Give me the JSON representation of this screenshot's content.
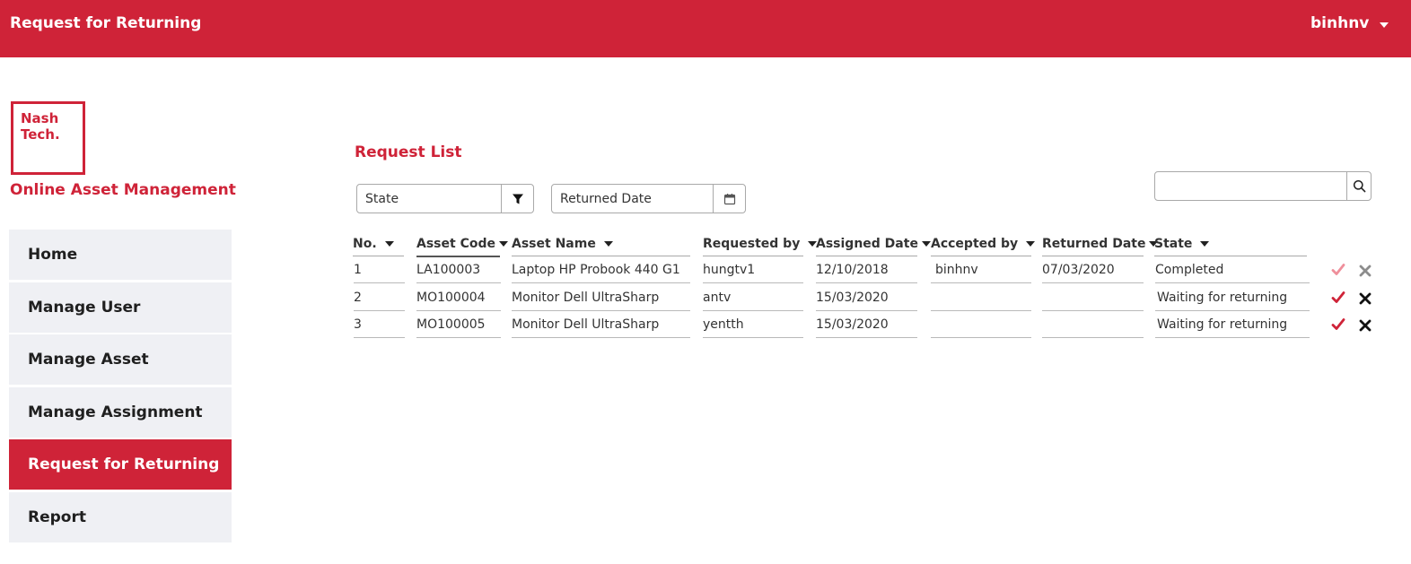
{
  "header": {
    "title": "Request for Returning",
    "user": "binhnv",
    "accent": "#cf2338"
  },
  "brand": {
    "logo_text": "Nash\nTech.",
    "app_name": "Online Asset Management"
  },
  "sidebar": {
    "items": [
      {
        "label": "Home"
      },
      {
        "label": "Manage User"
      },
      {
        "label": "Manage Asset"
      },
      {
        "label": "Manage Assignment"
      },
      {
        "label": "Request for Returning",
        "active": true
      },
      {
        "label": "Report"
      }
    ]
  },
  "main": {
    "title": "Request List",
    "filters": {
      "state_label": "State",
      "state_icon": "filter-icon",
      "returned_date_label": "Returned Date",
      "date_icon": "calendar-icon"
    },
    "search": {
      "value": "",
      "placeholder": "",
      "icon": "search-icon"
    },
    "table": {
      "columns": [
        "No.",
        "Asset Code",
        "Asset Name",
        "Requested by",
        "Assigned Date",
        "Accepted by",
        "Returned Date",
        "State"
      ],
      "rows": [
        {
          "no": "1",
          "asset_code": "LA100003",
          "asset_name": "Laptop HP Probook 440 G1",
          "requested_by": "hungtv1",
          "assigned_date": "12/10/2018",
          "accepted_by": "binhnv",
          "returned_date": "07/03/2020",
          "state": "Completed",
          "actions_enabled": false
        },
        {
          "no": "2",
          "asset_code": "MO100004",
          "asset_name": "Monitor Dell UltraSharp",
          "requested_by": "antv",
          "assigned_date": "15/03/2020",
          "accepted_by": "",
          "returned_date": "",
          "state": "Waiting for returning",
          "actions_enabled": true
        },
        {
          "no": "3",
          "asset_code": "MO100005",
          "asset_name": "Monitor Dell UltraSharp",
          "requested_by": "yentth",
          "assigned_date": "15/03/2020",
          "accepted_by": "",
          "returned_date": "",
          "state": "Waiting for returning",
          "actions_enabled": true
        }
      ],
      "action_icons": {
        "accept": "check-icon",
        "cancel": "close-icon"
      },
      "colors": {
        "accept": "#cf2338",
        "accept_disabled": "#ef8f9b",
        "cancel": "#111111",
        "cancel_disabled": "#8c8c8c"
      }
    }
  }
}
